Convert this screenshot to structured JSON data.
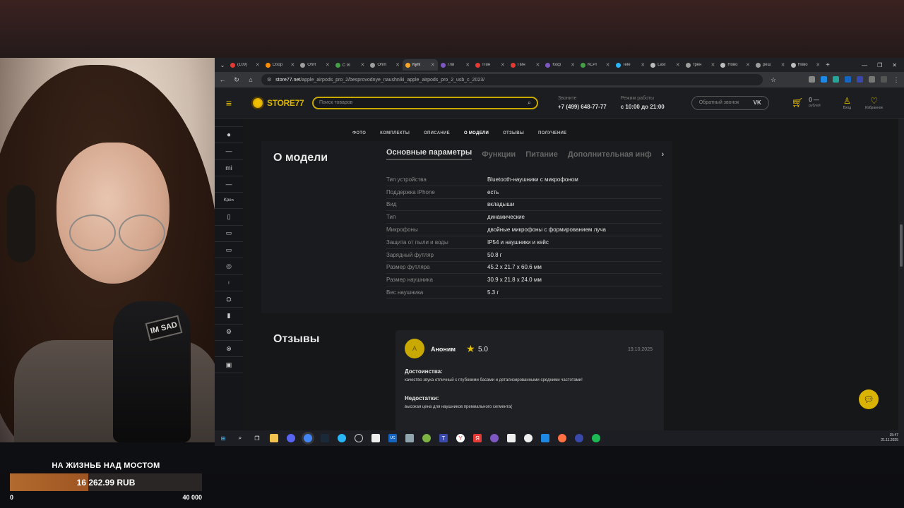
{
  "browser": {
    "tabs": [
      {
        "label": "(109)",
        "color": "#e53935"
      },
      {
        "label": "Сбор",
        "color": "#ff8f00"
      },
      {
        "label": "OhR",
        "color": "#9e9e9e"
      },
      {
        "label": "С ✉",
        "color": "#43a047"
      },
      {
        "label": "Ohm",
        "color": "#9e9e9e"
      },
      {
        "label": "Купі",
        "color": "#f9a825"
      },
      {
        "label": "Гли",
        "color": "#7e57c2"
      },
      {
        "label": "Пин",
        "color": "#e53935"
      },
      {
        "label": "Пин",
        "color": "#e53935"
      },
      {
        "label": "Коф",
        "color": "#7e57c2"
      },
      {
        "label": "KLPI",
        "color": "#43a047"
      },
      {
        "label": "Tele",
        "color": "#29b6f6"
      },
      {
        "label": "Last",
        "color": "#bbbbbb"
      },
      {
        "label": "трен",
        "color": "#9e9e9e"
      },
      {
        "label": "Ново",
        "color": "#bdbdbd"
      },
      {
        "label": "peш",
        "color": "#9e9e9e"
      },
      {
        "label": "Ново",
        "color": "#bdbdbd"
      }
    ],
    "active_tab_index": 5,
    "new_tab": "+",
    "url_domain": "store77.net",
    "url_path": "/apple_airpods_pro_2/besprovodnye_naushniki_apple_airpods_pro_2_usb_c_2023/"
  },
  "site": {
    "logo_part1": "STORE",
    "logo_part2": "77",
    "search_placeholder": "Поиск товаров",
    "phone_label": "Звоните",
    "phone": "+7 (499) 648-77-77",
    "hours_label": "Режим работы",
    "hours": "с 10:00 до 21:00",
    "callback": "Обратный звонок",
    "vk": "VK",
    "cart_amount": "0 —",
    "cart_currency": "рублей",
    "login": "Вход",
    "favorites": "Избранное"
  },
  "rail_icons": [
    "apple-icon",
    "dash-icon",
    "mi-icon",
    "dash-icon",
    "brand-icon",
    "phone-icon",
    "tablet-icon",
    "laptop-icon",
    "watch-icon",
    "earbuds-icon",
    "gamepad-icon",
    "speaker-icon",
    "settings-icon",
    "dyson-icon",
    "console-icon"
  ],
  "rail_glyphs": [
    "",
    "—",
    "mi",
    "—",
    "ᴷᵖᵉⁿ",
    "▯",
    "▭",
    "▭",
    "◎",
    "ᵎ",
    "⛭",
    "▮",
    "⚙",
    "⊗",
    "▣"
  ],
  "anchors": [
    "ФОТО",
    "КОМПЛЕКТЫ",
    "ОПИСАНИЕ",
    "О МОДЕЛИ",
    "ОТЗЫВЫ",
    "ПОЛУЧЕНИЕ"
  ],
  "anchors_active": 3,
  "model": {
    "title": "О модели",
    "tabs": [
      "Основные параметры",
      "Функции",
      "Питание",
      "Дополнительная инф"
    ],
    "specs": [
      {
        "k": "Тип устройства",
        "v": "Bluetooth-наушники с микрофоном"
      },
      {
        "k": "Поддержка iPhone",
        "v": "есть"
      },
      {
        "k": "Вид",
        "v": "вкладыши"
      },
      {
        "k": "Тип",
        "v": "динамические"
      },
      {
        "k": "Микрофоны",
        "v": "двойные микрофоны с формированием луча"
      },
      {
        "k": "Защита от пыли и воды",
        "v": "IP54 и наушники и кейс"
      },
      {
        "k": "Зарядный футляр",
        "v": "50.8 г"
      },
      {
        "k": "Размер футляра",
        "v": "45.2 х 21.7 х 60.6 мм"
      },
      {
        "k": "Размер наушника",
        "v": "30.9 х 21.8 х 24.0 мм"
      },
      {
        "k": "Вес наушника",
        "v": "5.3 г"
      }
    ]
  },
  "reviews": {
    "title": "Отзывы",
    "avatar_letter": "А",
    "name": "Аноним",
    "score": "5.0",
    "date": "19.10.2025",
    "pros_label": "Достоинства:",
    "pros": "качество звука отличный с глубокими басами и детализированными средними частотами!",
    "cons_label": "Недостатки:",
    "cons": "высокая цена для наушников премиального сегмента("
  },
  "taskbar": {
    "time": "15:47",
    "date": "21.11.2025"
  },
  "donation": {
    "title": "НА ЖИЗНЬБ НАД МОСТОМ",
    "amount": "16 262.99 RUB",
    "min": "0",
    "max": "40 000",
    "progress": 0.4066
  }
}
